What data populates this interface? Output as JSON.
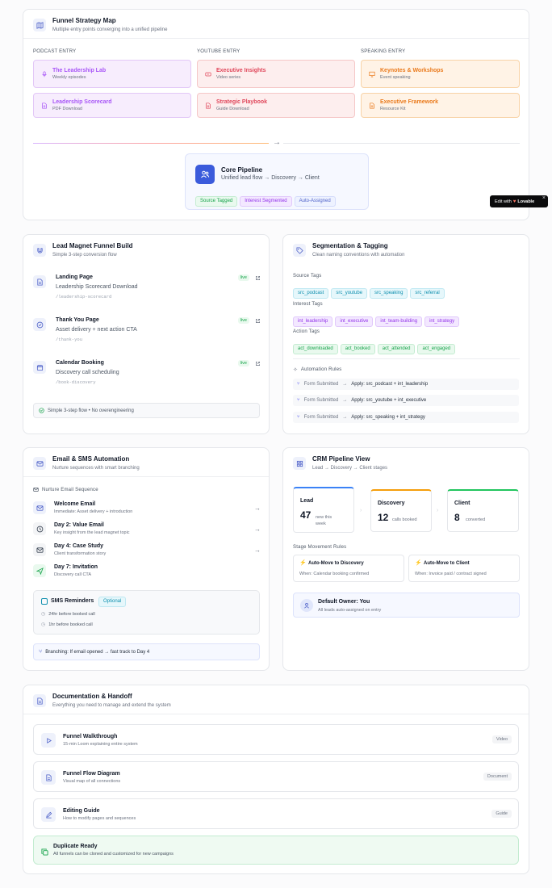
{
  "strategy": {
    "title": "Funnel Strategy Map",
    "subtitle": "Multiple entry points converging into a unified pipeline",
    "columns": [
      {
        "label": "PODCAST ENTRY",
        "items": [
          {
            "name": "The Leadership Lab",
            "sub": "Weekly episodes",
            "icon": "mic-icon"
          },
          {
            "name": "Leadership Scorecard",
            "sub": "PDF Download",
            "icon": "file-icon"
          }
        ]
      },
      {
        "label": "YOUTUBE ENTRY",
        "items": [
          {
            "name": "Executive Insights",
            "sub": "Video series",
            "icon": "youtube-icon"
          },
          {
            "name": "Strategic Playbook",
            "sub": "Guide Download",
            "icon": "file-icon"
          }
        ]
      },
      {
        "label": "SPEAKING ENTRY",
        "items": [
          {
            "name": "Keynotes & Workshops",
            "sub": "Event speaking",
            "icon": "presentation-icon"
          },
          {
            "name": "Executive Framework",
            "sub": "Resource Kit",
            "icon": "file-icon"
          }
        ]
      }
    ],
    "core": {
      "title": "Core Pipeline",
      "subtitle": "Unified lead flow → Discovery → Client",
      "tags": [
        "Source Tagged",
        "Interest Segmented",
        "Auto-Assigned"
      ]
    }
  },
  "badge": {
    "prefix": "Edit with",
    "brand": "Lovable",
    "close": "×"
  },
  "lead_magnet": {
    "title": "Lead Magnet Funnel Build",
    "subtitle": "Simple 3-step conversion flow",
    "steps": [
      {
        "title": "Landing Page",
        "desc": "Leadership Scorecard Download",
        "path": "/leadership-scorecard",
        "status": "live"
      },
      {
        "title": "Thank You Page",
        "desc": "Asset delivery + next action CTA",
        "path": "/thank-you",
        "status": "live"
      },
      {
        "title": "Calendar Booking",
        "desc": "Discovery call scheduling",
        "path": "/book-discovery",
        "status": "live"
      }
    ],
    "footer": "Simple 3-step flow • No overengineering"
  },
  "segmentation": {
    "title": "Segmentation & Tagging",
    "subtitle": "Clean naming conventions with automation",
    "source_label": "Source Tags",
    "source_tags": [
      "src_podcast",
      "src_youtube",
      "src_speaking",
      "src_referral"
    ],
    "interest_label": "Interest Tags",
    "interest_tags": [
      "int_leadership",
      "int_executive",
      "int_team-building",
      "int_strategy"
    ],
    "action_label": "Action Tags",
    "action_tags": [
      "act_downloaded",
      "act_booked",
      "act_attended",
      "act_engaged"
    ],
    "rules_label": "Automation Rules",
    "rules": [
      {
        "trigger": "Form Submitted",
        "action": "Apply: src_podcast + int_leadership"
      },
      {
        "trigger": "Form Submitted",
        "action": "Apply: src_youtube + int_executive"
      },
      {
        "trigger": "Form Submitted",
        "action": "Apply: src_speaking + int_strategy"
      }
    ]
  },
  "email": {
    "title": "Email & SMS Automation",
    "subtitle": "Nurture sequences with smart branching",
    "sequence_label": "Nurture Email Sequence",
    "emails": [
      {
        "title": "Welcome Email",
        "desc": "Immediate: Asset delivery + introduction"
      },
      {
        "title": "Day 2: Value Email",
        "desc": "Key insight from the lead magnet topic"
      },
      {
        "title": "Day 4: Case Study",
        "desc": "Client transformation story"
      },
      {
        "title": "Day 7: Invitation",
        "desc": "Discovery call CTA"
      }
    ],
    "sms_title": "SMS Reminders",
    "sms_badge": "Optional",
    "sms_items": [
      "24hr before booked call",
      "1hr before booked call"
    ],
    "branch": "Branching: If email opened → fast track to Day 4"
  },
  "crm": {
    "title": "CRM Pipeline View",
    "subtitle": "Lead → Discovery → Client stages",
    "stages": [
      {
        "name": "Lead",
        "value": "47",
        "desc": "new this week",
        "color": "#3b82f6"
      },
      {
        "name": "Discovery",
        "value": "12",
        "desc": "calls booked",
        "color": "#f59e0b"
      },
      {
        "name": "Client",
        "value": "8",
        "desc": "converted",
        "color": "#22c55e"
      }
    ],
    "rules_label": "Stage Movement Rules",
    "rules": [
      {
        "title": "Auto-Move to Discovery",
        "desc": "When: Calendar booking confirmed"
      },
      {
        "title": "Auto-Move to Client",
        "desc": "When: Invoice paid / contract signed"
      }
    ],
    "owner_title": "Default Owner: You",
    "owner_desc": "All leads auto-assigned on entry"
  },
  "docs": {
    "title": "Documentation & Handoff",
    "subtitle": "Everything you need to manage and extend the system",
    "items": [
      {
        "title": "Funnel Walkthrough",
        "desc": "15-min Loom explaining entire system",
        "tag": "Video"
      },
      {
        "title": "Funnel Flow Diagram",
        "desc": "Visual map of all connections",
        "tag": "Document"
      },
      {
        "title": "Editing Guide",
        "desc": "How to modify pages and sequences",
        "tag": "Guide"
      }
    ],
    "dup_title": "Duplicate Ready",
    "dup_desc": "All funnels can be cloned and customized for new campaigns"
  }
}
